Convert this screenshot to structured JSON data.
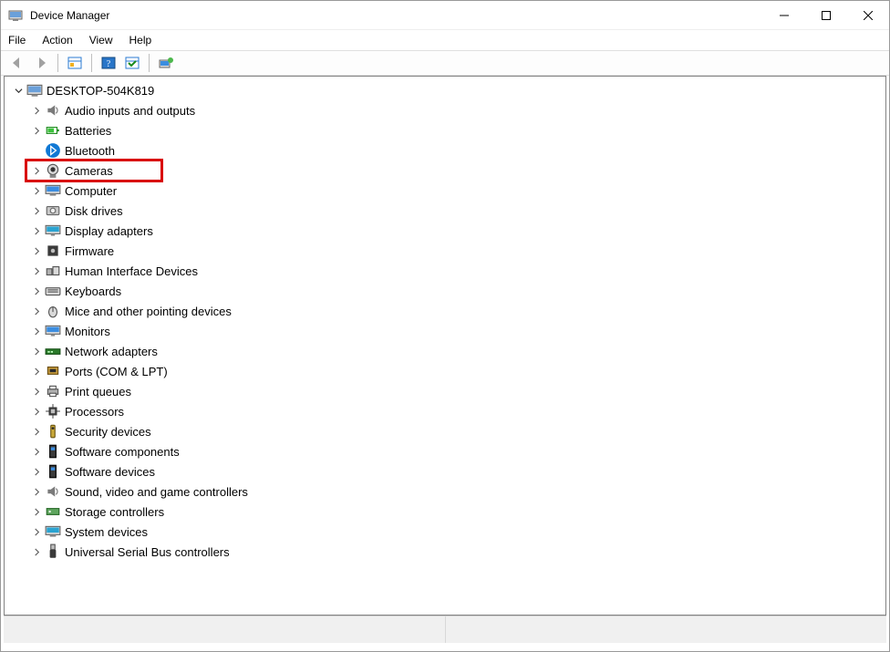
{
  "window": {
    "title": "Device Manager"
  },
  "menu": {
    "items": [
      "File",
      "Action",
      "View",
      "Help"
    ]
  },
  "tree": {
    "root": {
      "label": "DESKTOP-504K819",
      "expanded": true
    },
    "nodes": [
      {
        "label": "Audio inputs and outputs",
        "icon": "speaker",
        "highlighted": false
      },
      {
        "label": "Batteries",
        "icon": "battery",
        "highlighted": false
      },
      {
        "label": "Bluetooth",
        "icon": "bluetooth",
        "highlighted": false,
        "noExpander": true
      },
      {
        "label": "Cameras",
        "icon": "camera",
        "highlighted": true
      },
      {
        "label": "Computer",
        "icon": "computer",
        "highlighted": false
      },
      {
        "label": "Disk drives",
        "icon": "disk",
        "highlighted": false
      },
      {
        "label": "Display adapters",
        "icon": "display",
        "highlighted": false
      },
      {
        "label": "Firmware",
        "icon": "firmware",
        "highlighted": false
      },
      {
        "label": "Human Interface Devices",
        "icon": "hid",
        "highlighted": false
      },
      {
        "label": "Keyboards",
        "icon": "keyboard",
        "highlighted": false
      },
      {
        "label": "Mice and other pointing devices",
        "icon": "mouse",
        "highlighted": false
      },
      {
        "label": "Monitors",
        "icon": "monitor",
        "highlighted": false
      },
      {
        "label": "Network adapters",
        "icon": "network",
        "highlighted": false
      },
      {
        "label": "Ports (COM & LPT)",
        "icon": "port",
        "highlighted": false
      },
      {
        "label": "Print queues",
        "icon": "printer",
        "highlighted": false
      },
      {
        "label": "Processors",
        "icon": "cpu",
        "highlighted": false
      },
      {
        "label": "Security devices",
        "icon": "security",
        "highlighted": false
      },
      {
        "label": "Software components",
        "icon": "swcomp",
        "highlighted": false
      },
      {
        "label": "Software devices",
        "icon": "swdev",
        "highlighted": false
      },
      {
        "label": "Sound, video and game controllers",
        "icon": "sound",
        "highlighted": false
      },
      {
        "label": "Storage controllers",
        "icon": "storage",
        "highlighted": false
      },
      {
        "label": "System devices",
        "icon": "system",
        "highlighted": false
      },
      {
        "label": "Universal Serial Bus controllers",
        "icon": "usb",
        "highlighted": false
      }
    ]
  }
}
